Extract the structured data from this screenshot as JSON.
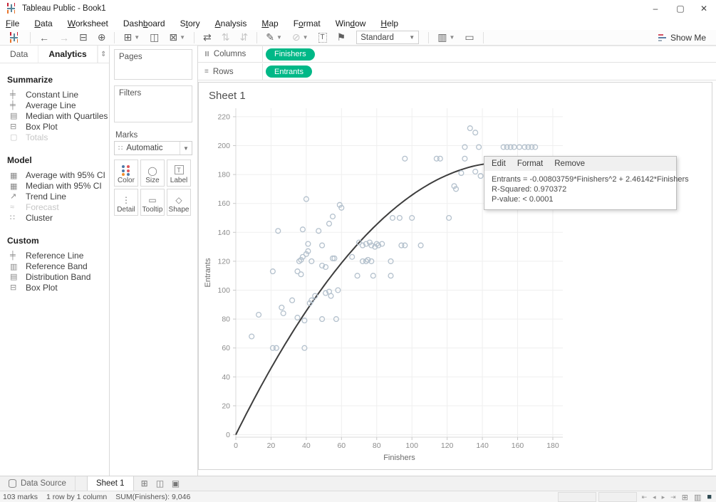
{
  "window": {
    "title": "Tableau Public - Book1",
    "minimize": "–",
    "maximize": "▢",
    "close": "✕"
  },
  "menu": {
    "items": [
      {
        "label": "File",
        "u": 0
      },
      {
        "label": "Data",
        "u": 0
      },
      {
        "label": "Worksheet",
        "u": 0
      },
      {
        "label": "Dashboard",
        "u": 4
      },
      {
        "label": "Story",
        "u": 1
      },
      {
        "label": "Analysis",
        "u": 0
      },
      {
        "label": "Map",
        "u": 0
      },
      {
        "label": "Format",
        "u": 1
      },
      {
        "label": "Window",
        "u": 3
      },
      {
        "label": "Help",
        "u": 0
      }
    ]
  },
  "toolbar": {
    "items": [
      {
        "type": "logo",
        "name": "tableau-logo-icon"
      },
      {
        "type": "sep"
      },
      {
        "name": "undo-button",
        "glyph": "←"
      },
      {
        "name": "redo-button",
        "glyph": "→",
        "disabled": true
      },
      {
        "name": "save-button",
        "glyph": "⊟"
      },
      {
        "name": "new-data-source-button",
        "glyph": "⊕"
      },
      {
        "type": "sep"
      },
      {
        "name": "new-worksheet-button",
        "glyph": "⊞",
        "caret": true
      },
      {
        "name": "duplicate-button",
        "glyph": "◫"
      },
      {
        "name": "clear-sheet-button",
        "glyph": "⊠",
        "caret": true
      },
      {
        "type": "sep"
      },
      {
        "name": "swap-rows-columns-button",
        "glyph": "⇄"
      },
      {
        "name": "sort-ascending-button",
        "glyph": "⇅",
        "disabled": true
      },
      {
        "name": "sort-descending-button",
        "glyph": "⇵",
        "disabled": true
      },
      {
        "type": "sep"
      },
      {
        "name": "highlight-button",
        "glyph": "✎",
        "caret": true
      },
      {
        "name": "paperclip-button",
        "glyph": "⊘",
        "disabled": true,
        "caret": true
      },
      {
        "name": "show-mark-labels-button",
        "glyph": "T",
        "boxed": true
      },
      {
        "name": "fix-axes-button",
        "glyph": "⚑"
      },
      {
        "type": "select",
        "name": "fit-select",
        "label": "Standard"
      },
      {
        "type": "sep"
      },
      {
        "name": "show-hide-cards-button",
        "glyph": "▥",
        "caret": true
      },
      {
        "name": "presentation-mode-button",
        "glyph": "▭"
      },
      {
        "type": "sep"
      }
    ],
    "show_me_label": "Show Me"
  },
  "sidebar": {
    "tabs": [
      {
        "label": "Data",
        "active": false
      },
      {
        "label": "Analytics",
        "active": true
      }
    ],
    "splitter_glyph": "⇕",
    "sections": [
      {
        "title": "Summarize",
        "items": [
          {
            "label": "Constant Line",
            "icon": "constant-line-icon",
            "glyph": "╪"
          },
          {
            "label": "Average Line",
            "icon": "average-line-icon",
            "glyph": "╪"
          },
          {
            "label": "Median with Quartiles",
            "icon": "median-quartiles-icon",
            "glyph": "▤"
          },
          {
            "label": "Box Plot",
            "icon": "box-plot-icon",
            "glyph": "⊟"
          },
          {
            "label": "Totals",
            "icon": "totals-icon",
            "glyph": "▢",
            "disabled": true
          }
        ]
      },
      {
        "title": "Model",
        "items": [
          {
            "label": "Average with 95% CI",
            "icon": "average-ci-icon",
            "glyph": "▦"
          },
          {
            "label": "Median with 95% CI",
            "icon": "median-ci-icon",
            "glyph": "▦"
          },
          {
            "label": "Trend Line",
            "icon": "trend-line-icon",
            "glyph": "↗"
          },
          {
            "label": "Forecast",
            "icon": "forecast-icon",
            "glyph": "≈",
            "disabled": true
          },
          {
            "label": "Cluster",
            "icon": "cluster-icon",
            "glyph": "∷"
          }
        ]
      },
      {
        "title": "Custom",
        "items": [
          {
            "label": "Reference Line",
            "icon": "reference-line-icon",
            "glyph": "╪"
          },
          {
            "label": "Reference Band",
            "icon": "reference-band-icon",
            "glyph": "▥"
          },
          {
            "label": "Distribution Band",
            "icon": "distribution-band-icon",
            "glyph": "▤"
          },
          {
            "label": "Box Plot",
            "icon": "box-plot-icon",
            "glyph": "⊟"
          }
        ]
      }
    ]
  },
  "panel": {
    "pages_label": "Pages",
    "filters_label": "Filters",
    "marks_label": "Marks",
    "marks_type_label": "Automatic",
    "marks_type_glyph": "∷",
    "marks_buttons": [
      {
        "label": "Color",
        "icon": "color-icon",
        "glyph": ""
      },
      {
        "label": "Size",
        "icon": "size-icon",
        "glyph": "◯"
      },
      {
        "label": "Label",
        "icon": "label-icon",
        "glyph": "T"
      },
      {
        "label": "Detail",
        "icon": "detail-icon",
        "glyph": "⋮"
      },
      {
        "label": "Tooltip",
        "icon": "tooltip-icon",
        "glyph": "▭"
      },
      {
        "label": "Shape",
        "icon": "shape-icon",
        "glyph": "◇"
      }
    ],
    "color_dot_colors": [
      "#4e79a7",
      "#e15759",
      "#4e79a7",
      "#e15759",
      "#f28e2b",
      "#4e79a7"
    ]
  },
  "shelves": {
    "columns_label": "Columns",
    "columns_icon_glyph": "Ⅲ",
    "rows_label": "Rows",
    "rows_icon_glyph": "≡",
    "columns_pills": [
      "Finishers"
    ],
    "rows_pills": [
      "Entrants"
    ]
  },
  "sheet": {
    "title": "Sheet 1"
  },
  "tooltip": {
    "menu": [
      "Edit",
      "Format",
      "Remove"
    ],
    "lines": [
      "Entrants = -0.00803759*Finishers^2 + 2.46142*Finishers",
      "R-Squared: 0.970372",
      "P-value: < 0.0001"
    ]
  },
  "chart_data": {
    "type": "scatter",
    "title": "Sheet 1",
    "xlabel": "Finishers",
    "ylabel": "Entrants",
    "xlim": [
      0,
      186
    ],
    "ylim": [
      0,
      228
    ],
    "x_ticks": [
      0,
      20,
      40,
      60,
      80,
      100,
      120,
      140,
      160,
      180
    ],
    "y_ticks": [
      0,
      20,
      40,
      60,
      80,
      100,
      120,
      140,
      160,
      180,
      200,
      220
    ],
    "grid": true,
    "marker": "open-circle",
    "marker_color": "#b4c1cd",
    "trend_color": "#3d3d3d",
    "points": [
      [
        9,
        68
      ],
      [
        13,
        83
      ],
      [
        21,
        60
      ],
      [
        23,
        60
      ],
      [
        26,
        88
      ],
      [
        27,
        84
      ],
      [
        32,
        93
      ],
      [
        35,
        81
      ],
      [
        39,
        79
      ],
      [
        39,
        60
      ],
      [
        42,
        91
      ],
      [
        43,
        93
      ],
      [
        45,
        96
      ],
      [
        49,
        80
      ],
      [
        51,
        98
      ],
      [
        53,
        99
      ],
      [
        54,
        96
      ],
      [
        57,
        80
      ],
      [
        58,
        100
      ],
      [
        21,
        113
      ],
      [
        35,
        113
      ],
      [
        37,
        111
      ],
      [
        69,
        110
      ],
      [
        78,
        110
      ],
      [
        88,
        110
      ],
      [
        36,
        120
      ],
      [
        37,
        121
      ],
      [
        38,
        123
      ],
      [
        40,
        125
      ],
      [
        41,
        127
      ],
      [
        43,
        120
      ],
      [
        49,
        117
      ],
      [
        51,
        116
      ],
      [
        55,
        122
      ],
      [
        56,
        122
      ],
      [
        66,
        123
      ],
      [
        72,
        120
      ],
      [
        74,
        120
      ],
      [
        75,
        121
      ],
      [
        77,
        120
      ],
      [
        88,
        120
      ],
      [
        41,
        132
      ],
      [
        49,
        131
      ],
      [
        70,
        133
      ],
      [
        72,
        131
      ],
      [
        74,
        132
      ],
      [
        76,
        133
      ],
      [
        77,
        131
      ],
      [
        79,
        130
      ],
      [
        80,
        132
      ],
      [
        81,
        131
      ],
      [
        83,
        132
      ],
      [
        94,
        131
      ],
      [
        96,
        131
      ],
      [
        105,
        131
      ],
      [
        24,
        141
      ],
      [
        38,
        142
      ],
      [
        47,
        141
      ],
      [
        53,
        146
      ],
      [
        55,
        151
      ],
      [
        59,
        159
      ],
      [
        60,
        157
      ],
      [
        89,
        150
      ],
      [
        93,
        150
      ],
      [
        100,
        150
      ],
      [
        121,
        150
      ],
      [
        40,
        163
      ],
      [
        124,
        172
      ],
      [
        125,
        170
      ],
      [
        128,
        181
      ],
      [
        136,
        182
      ],
      [
        139,
        179
      ],
      [
        96,
        191
      ],
      [
        114,
        191
      ],
      [
        116,
        191
      ],
      [
        130,
        191
      ],
      [
        130,
        199
      ],
      [
        138,
        199
      ],
      [
        152,
        199
      ],
      [
        154,
        199
      ],
      [
        156,
        199
      ],
      [
        158,
        199
      ],
      [
        161,
        199
      ],
      [
        164,
        199
      ],
      [
        166,
        199
      ],
      [
        168,
        199
      ],
      [
        170,
        199
      ],
      [
        133,
        212
      ],
      [
        136,
        209
      ]
    ],
    "trend": {
      "model": "quadratic",
      "equation": "Entrants = -0.00803759*Finishers^2 + 2.46142*Finishers",
      "coef_x2": -0.00803759,
      "coef_x": 2.46142,
      "r_squared": 0.970372,
      "p_value": "< 0.0001"
    }
  },
  "tabsbar": {
    "data_source_label": "Data Source",
    "sheet_tabs": [
      "Sheet 1"
    ],
    "icons": [
      {
        "name": "new-worksheet-icon",
        "glyph": "⊞"
      },
      {
        "name": "new-dashboard-icon",
        "glyph": "◫"
      },
      {
        "name": "new-story-icon",
        "glyph": "▣"
      }
    ]
  },
  "statusbar": {
    "marks_count": "103 marks",
    "dimensions": "1 row by 1 column",
    "aggregate": "SUM(Finishers): 9,046",
    "playback_glyphs": [
      "⇤",
      "◂",
      "▸",
      "⇥"
    ],
    "view_glyphs": [
      "⊞",
      "▥",
      "■"
    ]
  },
  "colors": {
    "pill_green": "#00b887",
    "grid_line": "#efefef",
    "axis_line": "#d8d8d8",
    "tick_label": "#8c8c8c",
    "axis_title": "#6b6b6b"
  }
}
